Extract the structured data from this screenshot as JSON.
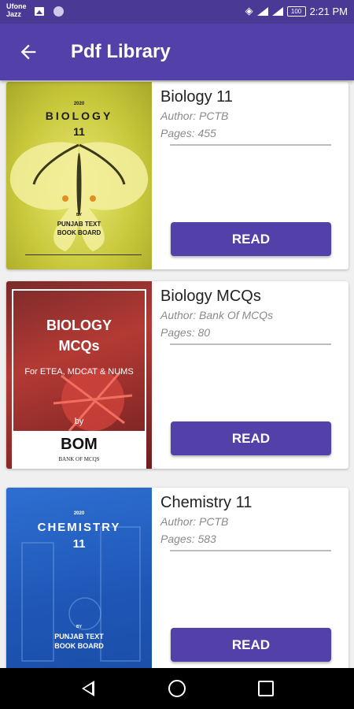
{
  "status_bar": {
    "carrier_line1": "Ufone",
    "carrier_line2": "Jazz",
    "battery": "100",
    "time": "2:21 PM"
  },
  "app_bar": {
    "title": "Pdf Library",
    "back_icon": "arrow-left-icon"
  },
  "books": [
    {
      "name": "Biology 11",
      "author": "Author: PCTB",
      "pages": "Pages: 455",
      "read_label": "READ",
      "cover": {
        "year": "2020",
        "line1": "BIOLOGY",
        "line2": "11",
        "by": "BY",
        "publisher1": "PUNJAB TEXT",
        "publisher2": "BOOK BOARD"
      }
    },
    {
      "name": "Biology MCQs",
      "author": "Author: Bank Of MCQs",
      "pages": "Pages: 80",
      "read_label": "READ",
      "cover": {
        "line1": "BIOLOGY",
        "line2": "MCQs",
        "sub": "For ETEA, MDCAT & NUMS",
        "by": "by",
        "logo": "BOM",
        "logo_sub": "BANK OF MCQS"
      }
    },
    {
      "name": "Chemistry 11",
      "author": "Author: PCTB",
      "pages": "Pages: 583",
      "read_label": "READ",
      "cover": {
        "year": "2020",
        "line1": "CHEMISTRY",
        "line2": "11",
        "by": "BY",
        "publisher1": "PUNJAB TEXT",
        "publisher2": "BOOK BOARD"
      }
    }
  ],
  "colors": {
    "status_bar": "#4b3a95",
    "app_bar": "#5340a8",
    "button": "#5340a8",
    "background": "#f0f0f0"
  }
}
